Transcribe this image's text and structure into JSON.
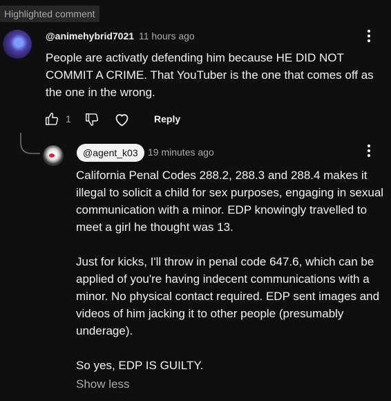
{
  "badge": "Highlighted comment",
  "comment": {
    "author": "@animehybrid7021",
    "time": "11 hours ago",
    "text": "People are activatly defending him because HE DID NOT COMMIT A CRIME. That YouTuber is the one that comes off as the one in the wrong.",
    "like_count": "1",
    "reply_label": "Reply"
  },
  "reply": {
    "author": "@agent_k03",
    "time": "19 minutes ago",
    "paragraphs": [
      "California Penal Codes 288.2, 288.3 and 288.4 makes it illegal to solicit a child for sex purposes, engaging in sexual communication with a minor. EDP knowingly travelled to meet a girl he thought was 13.",
      "Just for kicks, I'll throw in penal code 647.6, which can be applied of you're having indecent communications with a minor. No physical contact required. EDP sent images and videos of him jacking it to other people (presumably underage).",
      "So yes, EDP IS GUILTY."
    ],
    "show_less": "Show less"
  },
  "icons": {
    "menu": "more-vert-icon",
    "like": "thumb-up-icon",
    "dislike": "thumb-down-icon",
    "heart": "heart-icon",
    "thread": "thread-connector"
  }
}
